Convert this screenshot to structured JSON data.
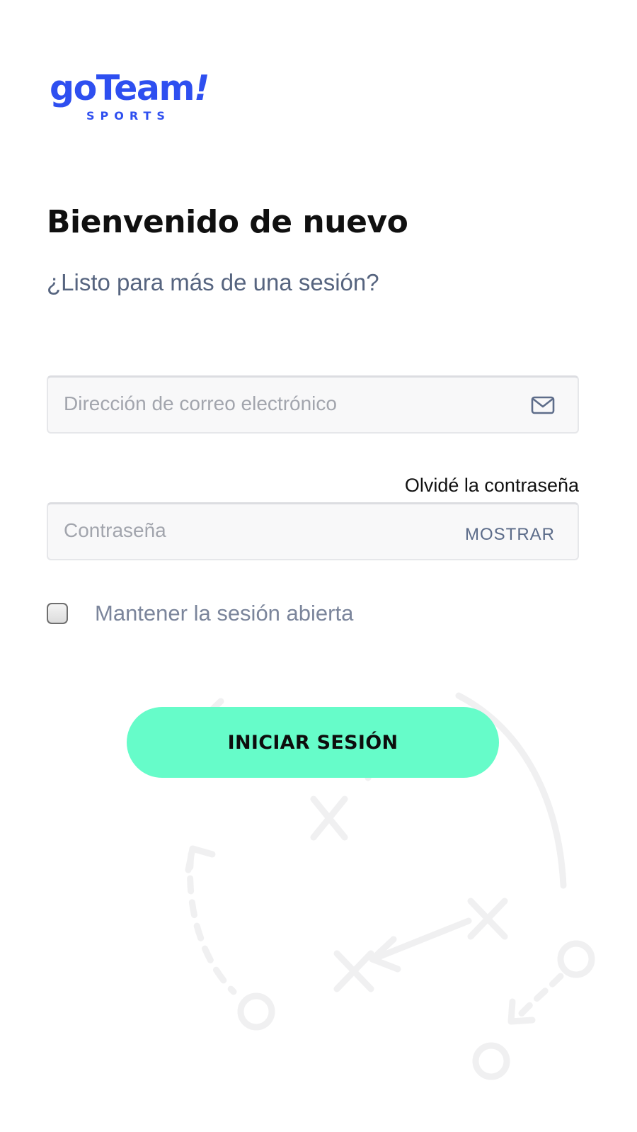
{
  "brand": {
    "logo_main": "goTeam",
    "logo_bang": "!",
    "logo_sub": "SPORTS",
    "color": "#2e4ff0"
  },
  "header": {
    "title": "Bienvenido de nuevo",
    "subtitle": "¿Listo para más de una sesión?"
  },
  "form": {
    "email": {
      "placeholder": "Dirección de correo electrónico",
      "value": "",
      "icon": "mail-icon"
    },
    "forgot_password": "Olvidé la contraseña",
    "password": {
      "placeholder": "Contraseña",
      "value": "",
      "show_label": "MOSTRAR"
    },
    "remember_me": {
      "label": "Mantener la sesión abierta",
      "checked": false
    },
    "submit_label": "INICIAR SESIÓN",
    "submit_color": "#66fcc9"
  }
}
